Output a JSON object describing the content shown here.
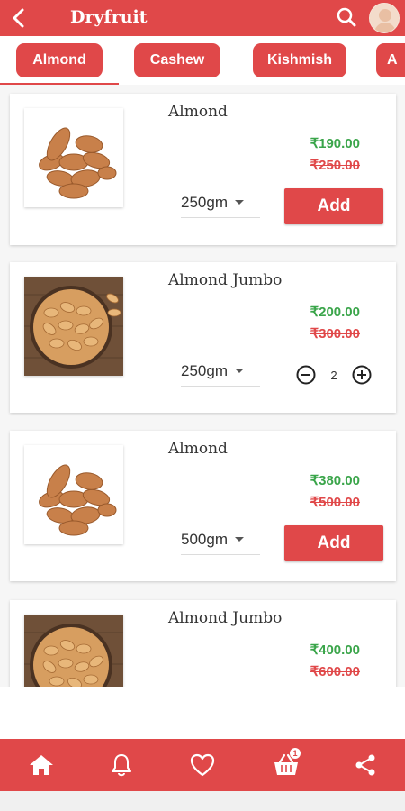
{
  "header": {
    "title": "Dryfruit",
    "back_icon": "back-arrow-icon",
    "search_icon": "search-icon",
    "avatar_icon": "user-avatar"
  },
  "tabs": [
    {
      "label": "Almond",
      "selected": true
    },
    {
      "label": "Cashew",
      "selected": false
    },
    {
      "label": "Kishmish",
      "selected": false
    },
    {
      "label": "A",
      "selected": false
    }
  ],
  "products": [
    {
      "name": "Almond",
      "price": "₹190.00",
      "mrp": "₹250.00",
      "weight": "250gm",
      "action": "Add",
      "image": "almonds-pile"
    },
    {
      "name": "Almond Jumbo",
      "price": "₹200.00",
      "mrp": "₹300.00",
      "weight": "250gm",
      "quantity": "2",
      "image": "almonds-bowl"
    },
    {
      "name": "Almond",
      "price": "₹380.00",
      "mrp": "₹500.00",
      "weight": "500gm",
      "action": "Add",
      "image": "almonds-pile"
    },
    {
      "name": "Almond Jumbo",
      "price": "₹400.00",
      "mrp": "₹600.00",
      "image": "almonds-bowl"
    }
  ],
  "bottom_nav": {
    "items": [
      "home-icon",
      "bell-icon",
      "heart-icon",
      "cart-icon",
      "share-icon"
    ],
    "cart_badge": "1"
  },
  "colors": {
    "primary": "#e04849",
    "price_green": "#3aa54a",
    "mrp_red": "#e04849"
  }
}
